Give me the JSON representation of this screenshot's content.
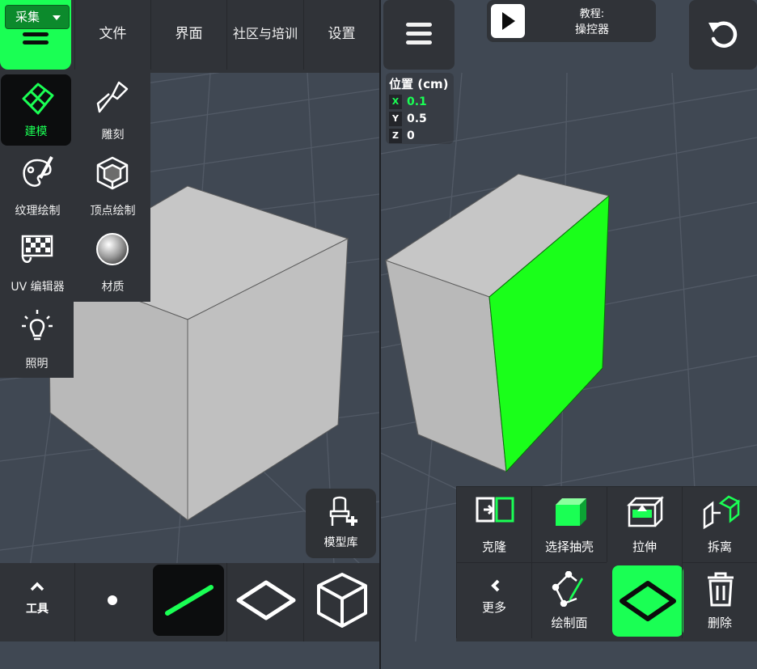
{
  "left": {
    "collect_label": "采集",
    "top_menu": [
      {
        "id": "file",
        "label": "文件"
      },
      {
        "id": "interface",
        "label": "界面"
      },
      {
        "id": "community",
        "label": "社区与培训"
      },
      {
        "id": "settings",
        "label": "设置"
      }
    ],
    "modes": [
      {
        "id": "modeling",
        "label": "建模",
        "active": true
      },
      {
        "id": "sculpt",
        "label": "雕刻"
      },
      {
        "id": "texture-paint",
        "label": "纹理绘制"
      },
      {
        "id": "vertex-paint",
        "label": "顶点绘制"
      },
      {
        "id": "uv-editor",
        "label": "UV 编辑器"
      },
      {
        "id": "material",
        "label": "材质"
      },
      {
        "id": "lighting",
        "label": "照明"
      }
    ],
    "model_library_label": "模型库",
    "tools_label": "工具",
    "selection_modes": [
      "vertex",
      "edge",
      "face",
      "object"
    ],
    "active_selection": "edge"
  },
  "right": {
    "tutorial": {
      "line1": "教程:",
      "line2": "操控器"
    },
    "position": {
      "title": "位置 (cm)",
      "x_label": "X",
      "x": "0.1",
      "y_label": "Y",
      "y": "0.5",
      "z_label": "Z",
      "z": "0"
    },
    "tools": {
      "clone": "克隆",
      "select_shell": "选择抽壳",
      "extrude": "拉伸",
      "detach": "拆离",
      "more": "更多",
      "draw_face": "绘制面",
      "draw_face_active": "",
      "delete": "删除"
    }
  },
  "colors": {
    "accent": "#1aff54",
    "panel": "#303338",
    "viewport": "#404853",
    "cube": "#c2c2c2"
  }
}
